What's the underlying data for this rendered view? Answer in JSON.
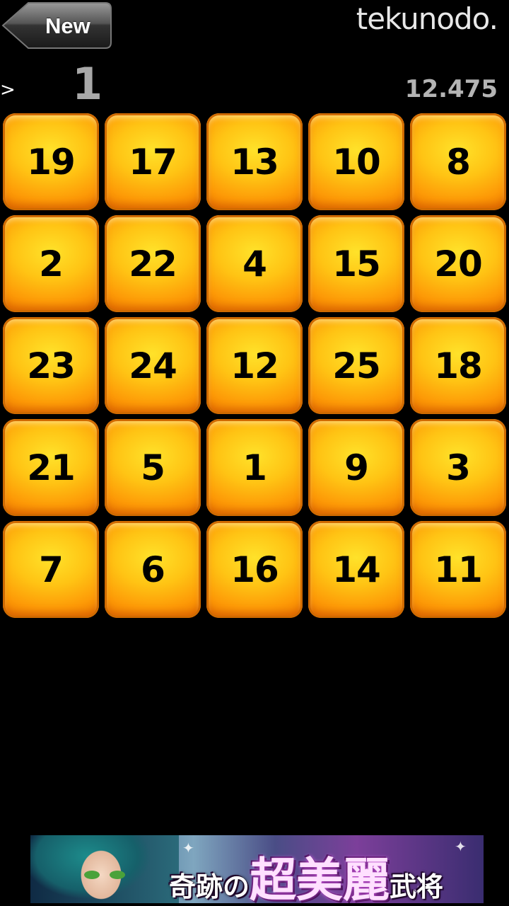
{
  "header": {
    "new_label": "New",
    "brand": "tekunodo."
  },
  "status": {
    "prompt": ">",
    "target": "1",
    "timer": "12.475"
  },
  "grid": {
    "tiles": [
      "19",
      "17",
      "13",
      "10",
      "8",
      "2",
      "22",
      "4",
      "15",
      "20",
      "23",
      "24",
      "12",
      "25",
      "18",
      "21",
      "5",
      "1",
      "9",
      "3",
      "7",
      "6",
      "16",
      "14",
      "11"
    ]
  },
  "ad": {
    "text_small_1": "奇跡の",
    "text_big": "超美麗",
    "text_small_2": "武将"
  },
  "colors": {
    "background": "#000000",
    "tile_orange": "#fd9a07",
    "tile_yellow": "#ffe22a",
    "number": "#000000"
  }
}
